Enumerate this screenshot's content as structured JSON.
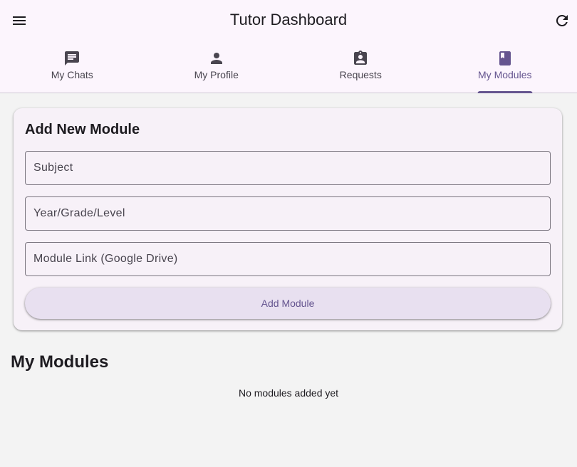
{
  "appbar": {
    "title": "Tutor Dashboard",
    "menu_icon": "menu-icon",
    "refresh_icon": "refresh-icon"
  },
  "tabs": [
    {
      "label": "My Chats",
      "icon": "chat-icon",
      "active": false
    },
    {
      "label": "My Profile",
      "icon": "person-icon",
      "active": false
    },
    {
      "label": "Requests",
      "icon": "assignment-ind-icon",
      "active": false
    },
    {
      "label": "My Modules",
      "icon": "book-icon",
      "active": true
    }
  ],
  "form": {
    "title": "Add New Module",
    "subject_placeholder": "Subject",
    "subject_value": "",
    "level_placeholder": "Year/Grade/Level",
    "level_value": "",
    "link_placeholder": "Module Link (Google Drive)",
    "link_value": "",
    "submit_label": "Add Module"
  },
  "modules": {
    "title": "My Modules",
    "empty_text": "No modules added yet",
    "items": []
  },
  "colors": {
    "accent": "#65558f",
    "appbar_bg": "#fcf5fd",
    "page_bg": "#f3f3f3",
    "card_bg": "#f7f1f8",
    "button_bg": "#e8e0f0"
  }
}
